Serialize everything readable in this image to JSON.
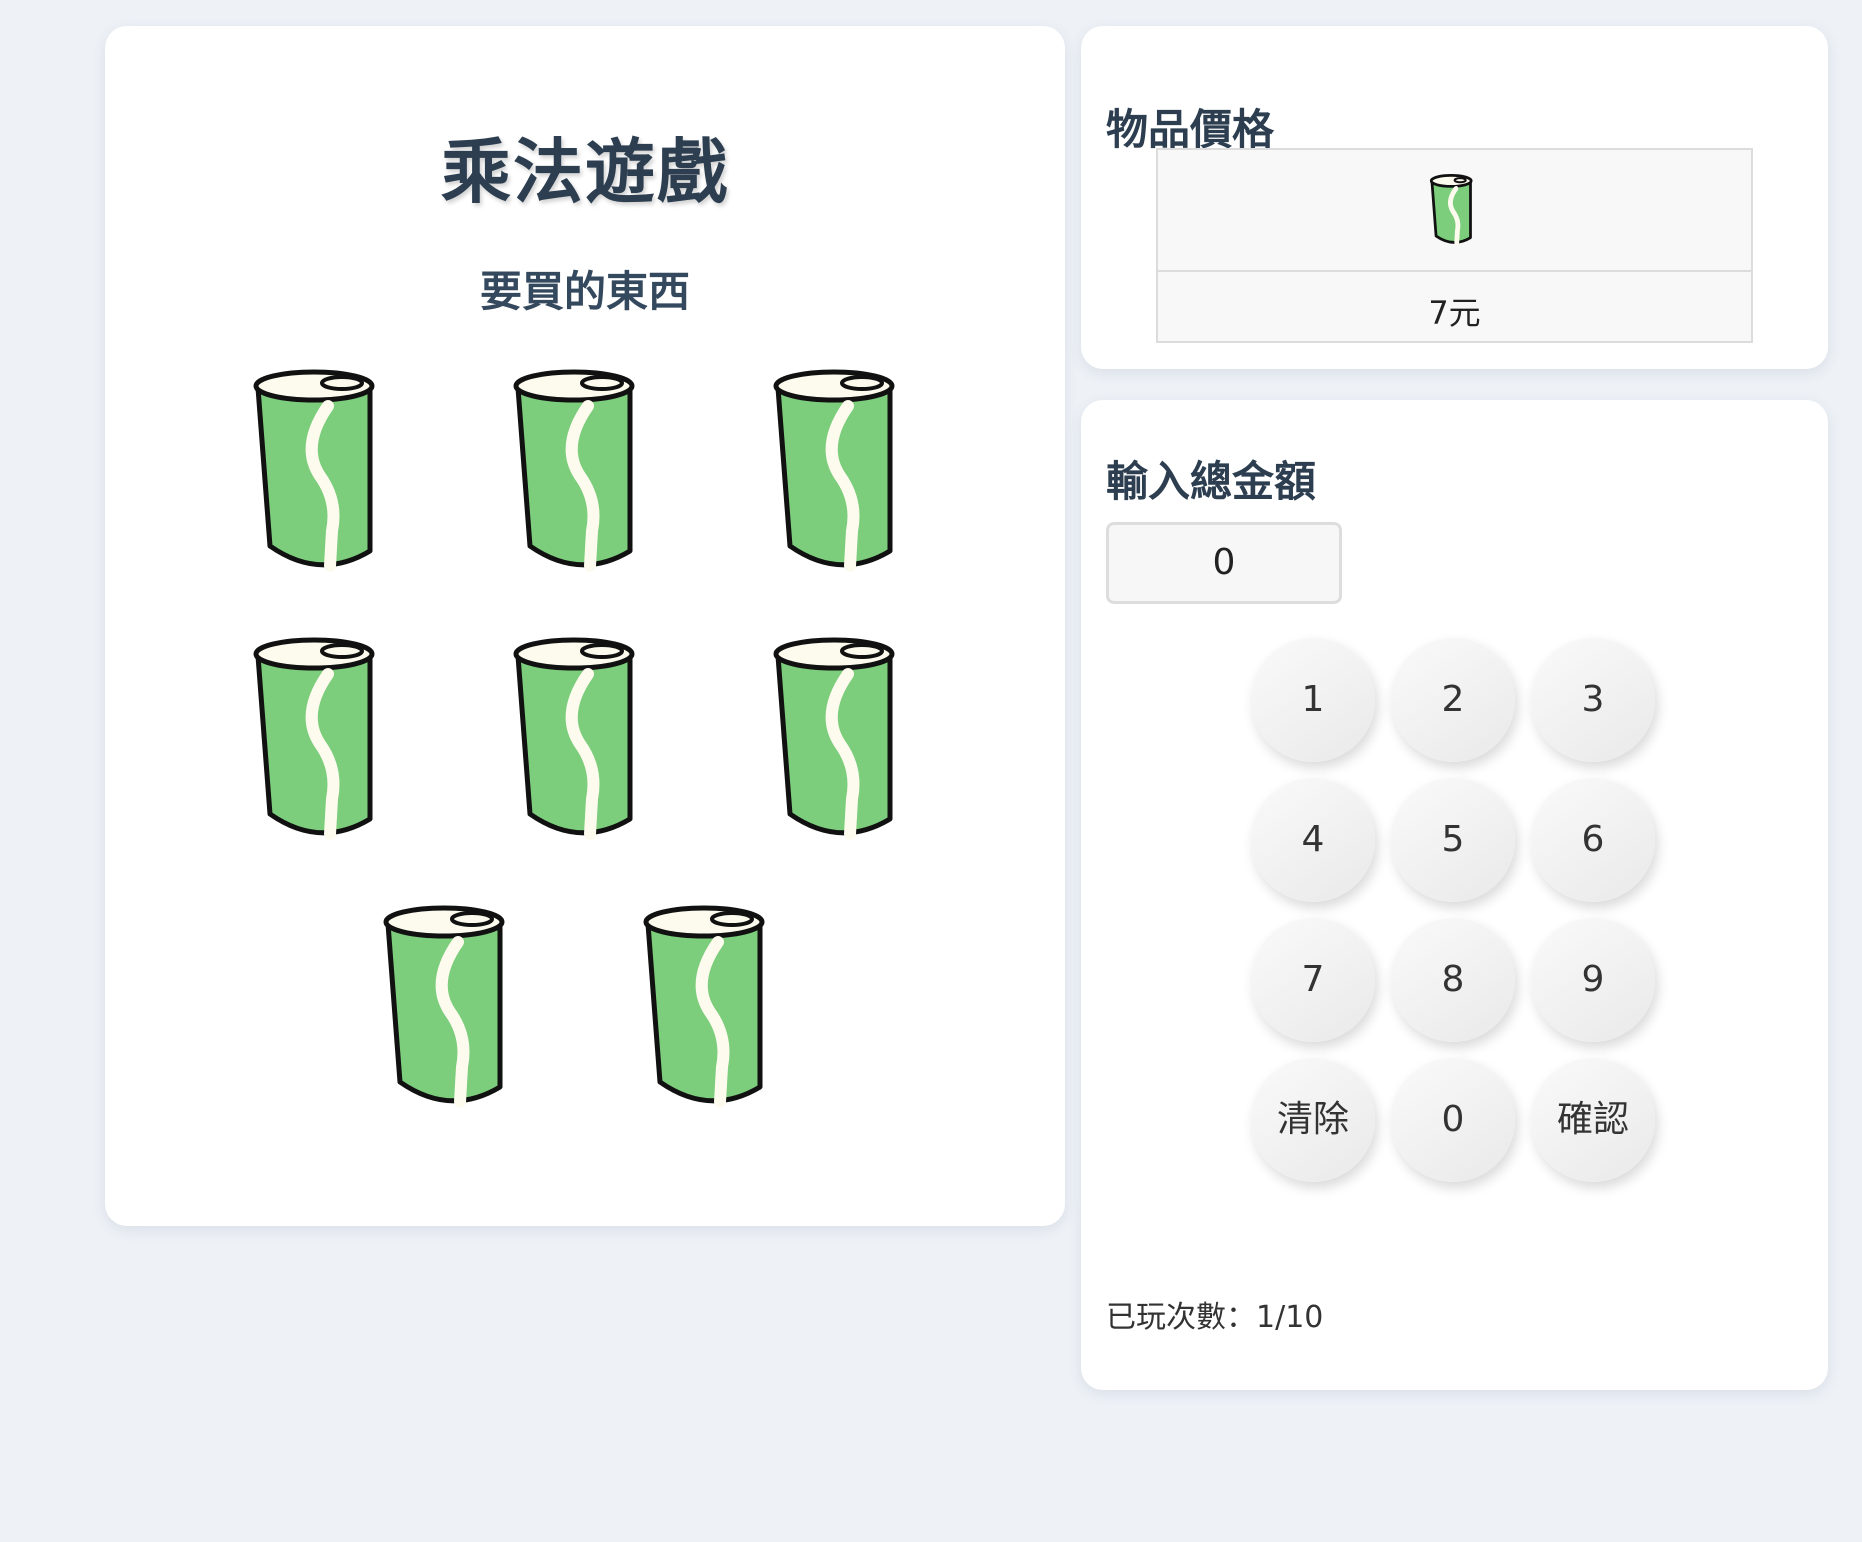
{
  "game": {
    "title": "乘法遊戲",
    "subtitle": "要買的東西",
    "item_icon": "green-can-icon",
    "item_count": 8
  },
  "price_panel": {
    "heading": "物品價格",
    "item_icon": "green-can-icon",
    "price_label": "7元"
  },
  "input_panel": {
    "heading": "輸入總金額",
    "current_value": "0",
    "keys": [
      "1",
      "2",
      "3",
      "4",
      "5",
      "6",
      "7",
      "8",
      "9",
      "清除",
      "0",
      "確認"
    ],
    "play_count_label": "已玩次數：1/10"
  },
  "colors": {
    "background": "#eef2f7",
    "card": "#ffffff",
    "heading": "#2c3e50",
    "can_green": "#7ccd7c",
    "can_stripe": "#fdfbee"
  }
}
